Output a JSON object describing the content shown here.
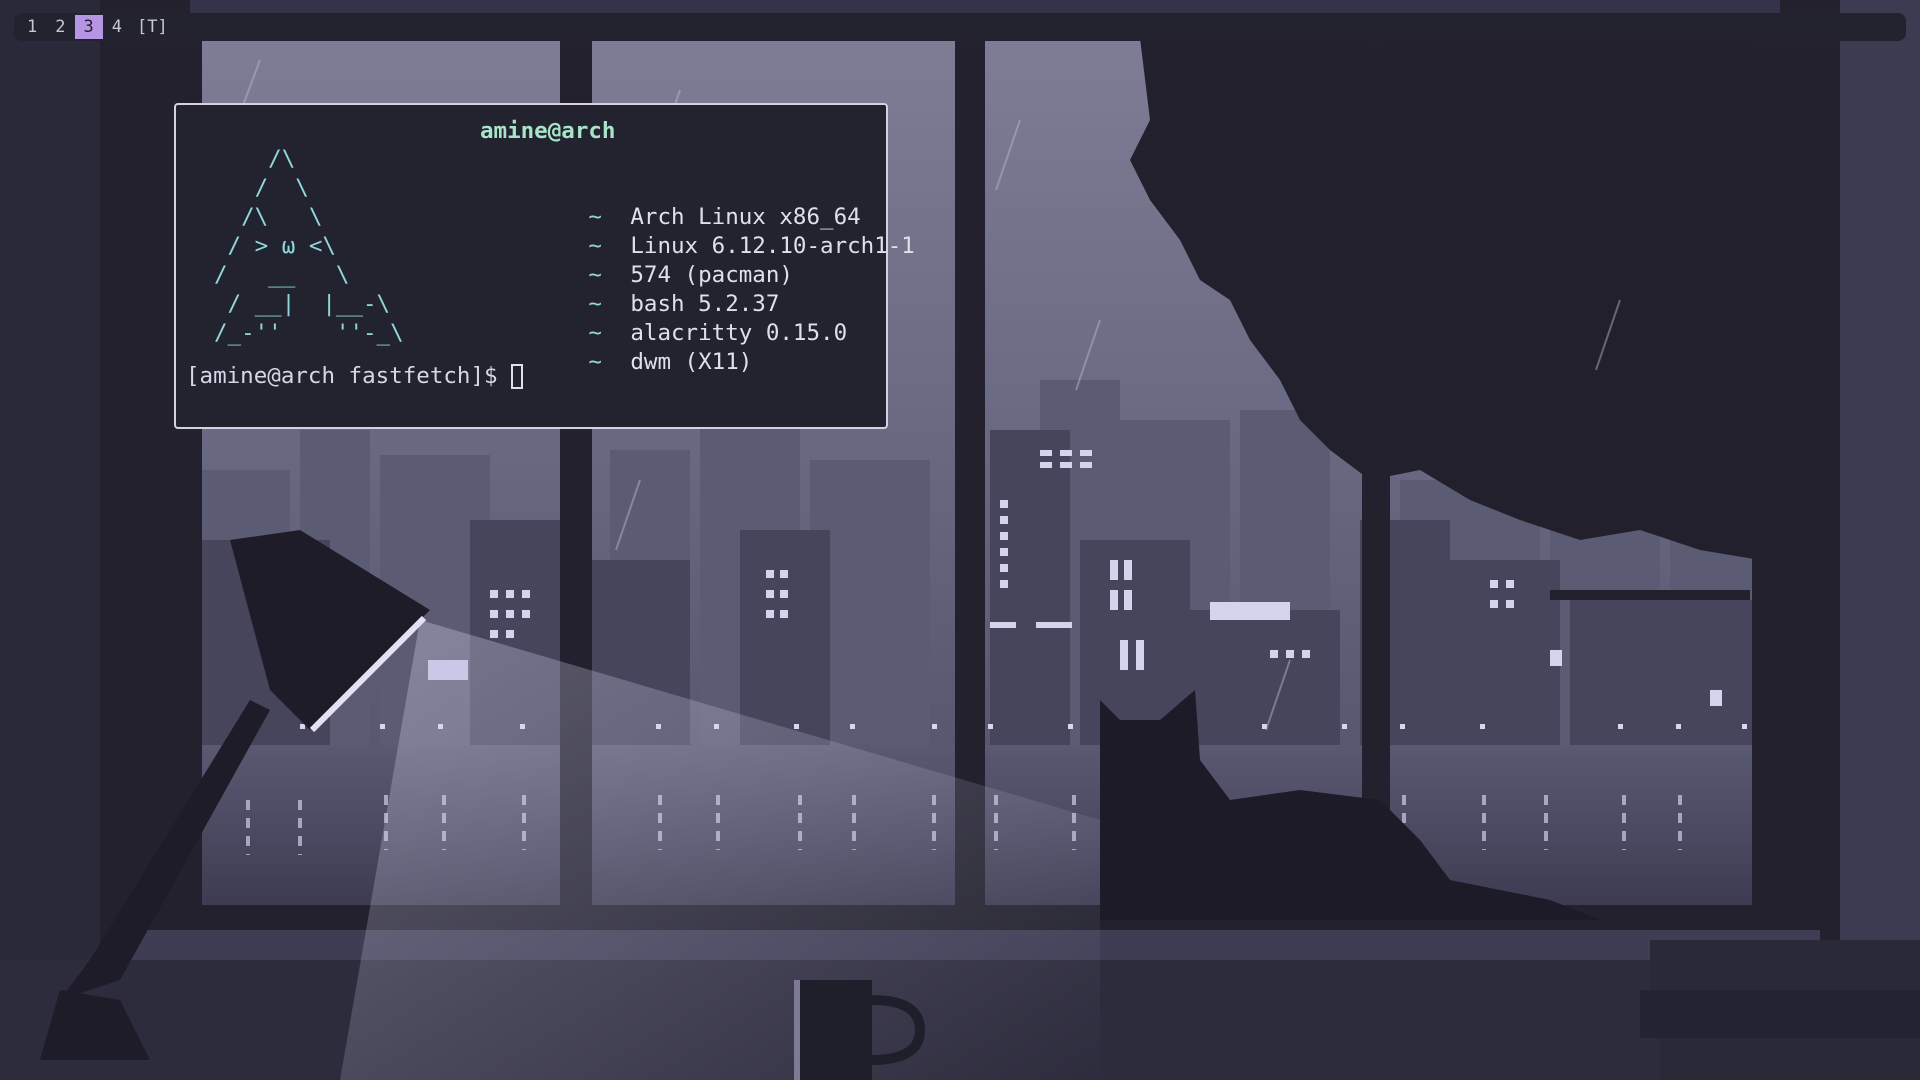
{
  "bar": {
    "tags": [
      "1",
      "2",
      "3",
      "4"
    ],
    "active_tag": "3",
    "layout_symbol": "[T]"
  },
  "terminal": {
    "app": "alacritty",
    "userhost": "amine@arch",
    "logo_lines": [
      "    /\\",
      "   /  \\",
      "  /\\   \\",
      " / > ω <\\",
      "/   __   \\",
      " / __|  |__-\\",
      "/_-''    ''-_\\"
    ],
    "info": [
      {
        "icon": "~",
        "value": "Arch Linux x86_64"
      },
      {
        "icon": "~",
        "value": "Linux 6.12.10-arch1-1"
      },
      {
        "icon": "~",
        "value": "574 (pacman)"
      },
      {
        "icon": "~",
        "value": "bash 5.2.37"
      },
      {
        "icon": "~",
        "value": "alacritty 0.15.0"
      },
      {
        "icon": "~",
        "value": "dwm (X11)"
      }
    ],
    "prompt": "[amine@arch fastfetch]$"
  },
  "wallpaper": {
    "description_icons": [
      "lamp-icon",
      "cat-icon",
      "mug-icon",
      "books-icon"
    ],
    "colors": {
      "sky": "#6b6a82",
      "building": "#4a4960",
      "frame": "#23222e",
      "light": "#c8c5e0"
    }
  }
}
